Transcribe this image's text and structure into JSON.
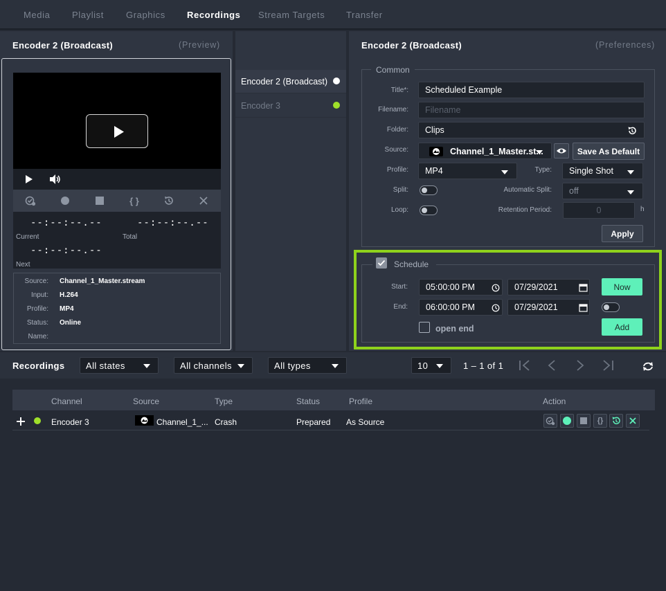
{
  "nav": {
    "tabs": [
      "Media",
      "Playlist",
      "Graphics",
      "Recordings",
      "Stream Targets",
      "Transfer"
    ],
    "active": "Recordings"
  },
  "preview": {
    "title": "Encoder 2 (Broadcast)",
    "subtitle": "(Preview)",
    "current_time": "--:--:--.--",
    "current_label": "Current",
    "total_time": "--:--:--.--",
    "total_label": "Total",
    "next_time": "--:--:--.--",
    "next_label": "Next",
    "info": [
      {
        "label": "Source:",
        "value": "Channel_1_Master.stream"
      },
      {
        "label": "Input:",
        "value": "H.264"
      },
      {
        "label": "Profile:",
        "value": "MP4"
      },
      {
        "label": "Status:",
        "value": "Online"
      },
      {
        "label": "Name:",
        "value": ""
      }
    ]
  },
  "encoders": [
    {
      "name": "Encoder 2 (Broadcast)",
      "dot": "#ffffff",
      "selected": true
    },
    {
      "name": "Encoder 3",
      "dot": "#9fe02a",
      "selected": false
    }
  ],
  "prefs": {
    "title": "Encoder 2 (Broadcast)",
    "subtitle": "(Preferences)",
    "common_legend": "Common",
    "title_label": "Title*:",
    "title_value": "Scheduled Example",
    "filename_label": "Filename:",
    "filename_placeholder": "Filename",
    "folder_label": "Folder:",
    "folder_value": "Clips",
    "source_label": "Source:",
    "source_value": "Channel_1_Master.st...",
    "save_default": "Save As Default",
    "profile_label": "Profile:",
    "profile_value": "MP4",
    "type_label": "Type:",
    "type_value": "Single Shot",
    "split_label": "Split:",
    "auto_split_label": "Automatic Split:",
    "auto_split_value": "off",
    "loop_label": "Loop:",
    "retention_label": "Retention Period:",
    "retention_value": "0",
    "retention_unit": "h",
    "apply": "Apply"
  },
  "schedule": {
    "legend": "Schedule",
    "start_label": "Start:",
    "start_time": "05:00:00 PM",
    "start_date": "07/29/2021",
    "end_label": "End:",
    "end_time": "06:00:00 PM",
    "end_date": "07/29/2021",
    "now": "Now",
    "add": "Add",
    "open_end": "open end",
    "highlight_color": "#8ed21c"
  },
  "recordings": {
    "title": "Recordings",
    "filters": [
      "All states",
      "All channels",
      "All types"
    ],
    "page_size": "10",
    "pager": "1 – 1 of 1",
    "columns": [
      "Channel",
      "Source",
      "Type",
      "Status",
      "Profile",
      "Action"
    ],
    "rows": [
      {
        "channel": "Encoder 3",
        "source": "Channel_1_...",
        "type": "Crash",
        "status": "Prepared",
        "profile": "As Source"
      }
    ]
  },
  "colors": {
    "accent": "#5ef0b9",
    "green_dot": "#9fe02a"
  }
}
